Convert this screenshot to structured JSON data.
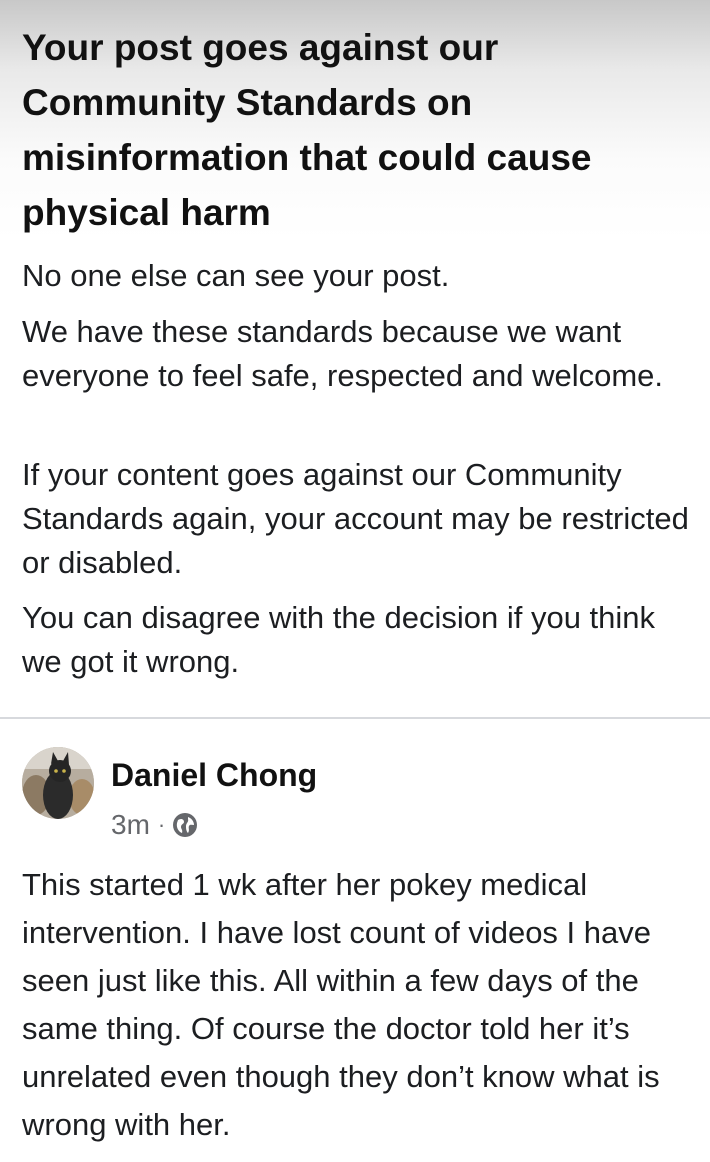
{
  "notice": {
    "title": "Your post goes against our Community Standards on misinformation that could cause physical harm",
    "paragraph_1": "No one else can see your post.",
    "paragraph_2": "We have these standards because we want everyone to feel safe, respected and welcome.",
    "paragraph_3": "If your content goes against our Community Standards again, your account may be restricted or disabled.",
    "paragraph_4": "You can disagree with the decision if you think we got it wrong."
  },
  "post": {
    "author": "Daniel Chong",
    "time": "3m",
    "separator": "·",
    "audience_icon": "globe-icon",
    "body": "This started 1 wk after her pokey medical intervention. I have lost count of videos I have seen just like this. All within a few days of the same thing. Of course the doctor told her it’s unrelated even though they don’t know what is wrong with her."
  }
}
